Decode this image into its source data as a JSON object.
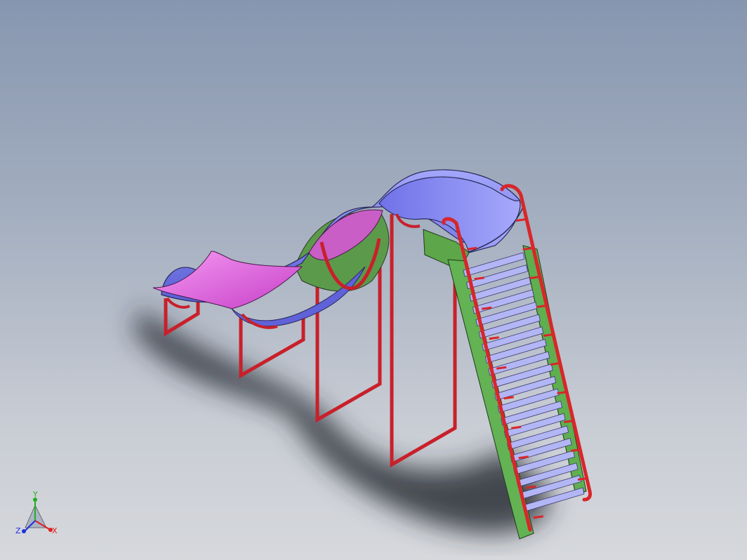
{
  "viewport": {
    "background_top": "#8796b0",
    "background_bottom": "#d6d8dc"
  },
  "model": {
    "components": [
      {
        "name": "wave-slide-chute",
        "colors": [
          "#ea7ae8",
          "#8a8df0",
          "#5b9a4a"
        ]
      },
      {
        "name": "support-frames",
        "colors": [
          "#d8262a"
        ]
      },
      {
        "name": "ladder-stringer",
        "colors": [
          "#6cbc58"
        ]
      },
      {
        "name": "ladder-steps",
        "colors": [
          "#b0b4f2"
        ]
      },
      {
        "name": "handrails",
        "colors": [
          "#d8262a"
        ]
      }
    ]
  },
  "triad": {
    "x_label": "X",
    "y_label": "Y",
    "z_label": "Z",
    "x_color": "#e02020",
    "y_color": "#20b020",
    "z_color": "#2030e0"
  }
}
